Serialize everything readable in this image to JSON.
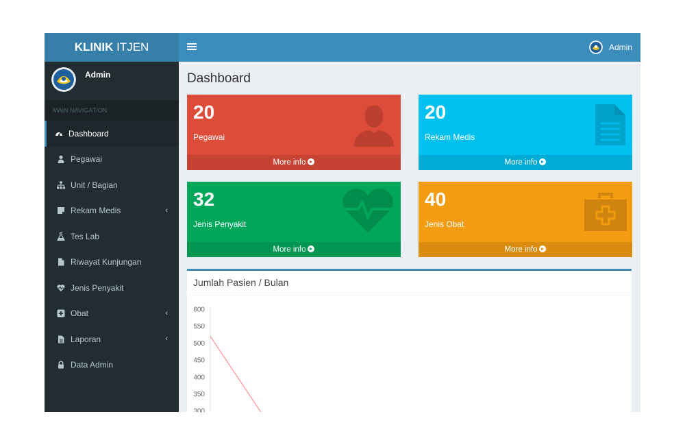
{
  "app": {
    "logo_bold": "KLINIK",
    "logo_light": " ITJEN"
  },
  "navbar": {
    "user_name": "Admin"
  },
  "sidebar": {
    "user_name": "Admin",
    "header": "MAIN NAVIGATION",
    "items": [
      {
        "label": "Dashboard",
        "icon": "dashboard-icon",
        "active": true,
        "has_children": false
      },
      {
        "label": "Pegawai",
        "icon": "user-icon",
        "has_children": false
      },
      {
        "label": "Unit / Bagian",
        "icon": "sitemap-icon",
        "has_children": false
      },
      {
        "label": "Rekam Medis",
        "icon": "sticky-note-icon",
        "has_children": true
      },
      {
        "label": "Tes Lab",
        "icon": "flask-icon",
        "has_children": false
      },
      {
        "label": "Riwayat Kunjungan",
        "icon": "file-icon",
        "has_children": false
      },
      {
        "label": "Jenis Penyakit",
        "icon": "heartbeat-icon",
        "has_children": false
      },
      {
        "label": "Obat",
        "icon": "plus-square-icon",
        "has_children": true
      },
      {
        "label": "Laporan",
        "icon": "file-text-icon",
        "has_children": true
      },
      {
        "label": "Data Admin",
        "icon": "lock-icon",
        "has_children": false
      }
    ],
    "chevron": "‹"
  },
  "page": {
    "title": "Dashboard"
  },
  "boxes": [
    {
      "value": "20",
      "label": "Pegawai",
      "footer": "More info",
      "color": "#dd4b39",
      "icon": "user-icon"
    },
    {
      "value": "20",
      "label": "Rekam Medis",
      "footer": "More info",
      "color": "#00c0ef",
      "icon": "file-text-icon"
    },
    {
      "value": "32",
      "label": "Jenis Penyakit",
      "footer": "More info",
      "color": "#00a65a",
      "icon": "heartbeat-icon"
    },
    {
      "value": "40",
      "label": "Jenis Obat",
      "footer": "More info",
      "color": "#f39c12",
      "icon": "medkit-icon"
    }
  ],
  "chart": {
    "title": "Jumlah Pasien / Bulan"
  },
  "chart_data": {
    "type": "line",
    "title": "Jumlah Pasien / Bulan",
    "y_ticks": [
      "600",
      "550",
      "500",
      "450",
      "400",
      "350",
      "300"
    ],
    "ylim": [
      300,
      600
    ],
    "series": [
      {
        "color": "#f8a5a5",
        "points": [
          {
            "x": 0,
            "y": 520
          },
          {
            "x": 1,
            "y": 290
          }
        ]
      }
    ],
    "grid": false
  }
}
